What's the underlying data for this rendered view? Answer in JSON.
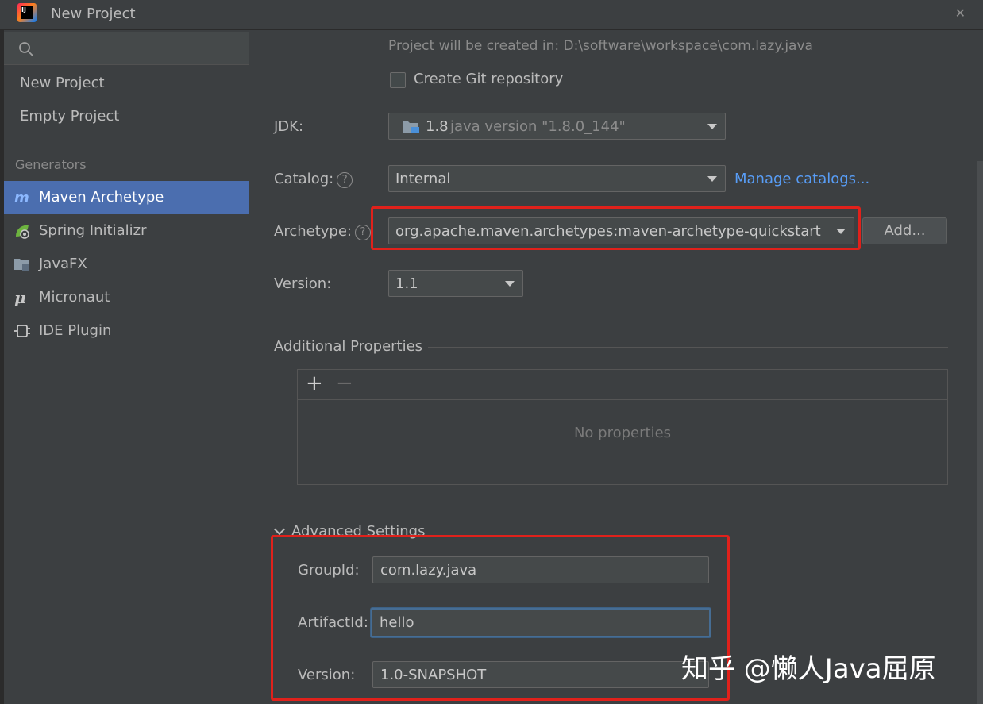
{
  "window": {
    "title": "New Project"
  },
  "sidebar": {
    "search_placeholder": "",
    "items": [
      {
        "label": "New Project"
      },
      {
        "label": "Empty Project"
      }
    ],
    "generators_label": "Generators",
    "generators": [
      {
        "label": "Maven Archetype",
        "icon": "maven-icon",
        "selected": true
      },
      {
        "label": "Spring Initializr",
        "icon": "spring-icon"
      },
      {
        "label": "JavaFX",
        "icon": "javafx-folder-icon"
      },
      {
        "label": "Micronaut",
        "icon": "micronaut-icon"
      },
      {
        "label": "IDE Plugin",
        "icon": "plugin-icon"
      }
    ]
  },
  "main": {
    "location_hint": "Project will be created in: D:\\software\\workspace\\com.lazy.java",
    "create_git_label": "Create Git repository",
    "jdk_label": "JDK:",
    "jdk_version": "1.8",
    "jdk_detail": "java version \"1.8.0_144\"",
    "catalog_label": "Catalog:",
    "catalog_value": "Internal",
    "manage_catalogs": "Manage catalogs...",
    "archetype_label": "Archetype:",
    "archetype_value": "org.apache.maven.archetypes:maven-archetype-quickstart",
    "add_button": "Add...",
    "version_label": "Version:",
    "version_value": "1.1",
    "additional_properties": "Additional Properties",
    "no_properties": "No properties",
    "advanced_settings": "Advanced Settings",
    "group_id_label": "GroupId:",
    "group_id_value": "com.lazy.java",
    "artifact_id_label": "ArtifactId:",
    "artifact_id_value": "hello",
    "adv_version_label": "Version:",
    "adv_version_value": "1.0-SNAPSHOT"
  },
  "watermark": "知乎 @懒人Java屈原",
  "colors": {
    "selection": "#4b6eaf",
    "link": "#589df6",
    "highlight": "#e0211b"
  }
}
